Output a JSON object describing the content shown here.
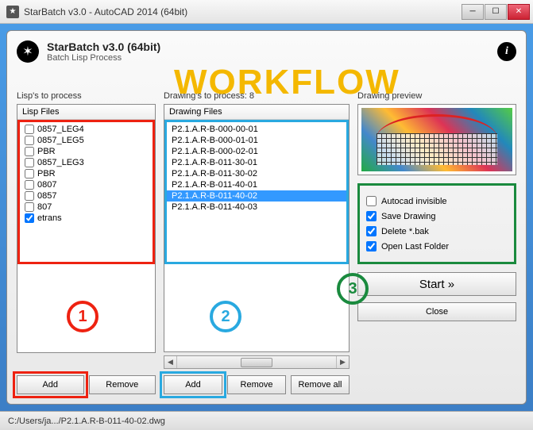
{
  "titlebar": {
    "text": "StarBatch v3.0 - AutoCAD 2014 (64bit)"
  },
  "header": {
    "title": "StarBatch v3.0 (64bit)",
    "subtitle": "Batch Lisp Process"
  },
  "overlay": {
    "workflow": "WORKFLOW"
  },
  "badges": {
    "b1": "1",
    "b2": "2",
    "b3": "3"
  },
  "lisps": {
    "title": "Lisp's to process",
    "header": "Lisp Files",
    "items": [
      {
        "label": "0857_LEG4",
        "checked": false
      },
      {
        "label": "0857_LEG5",
        "checked": false
      },
      {
        "label": "PBR",
        "checked": false
      },
      {
        "label": "0857_LEG3",
        "checked": false
      },
      {
        "label": "PBR",
        "checked": false
      },
      {
        "label": "0807",
        "checked": false
      },
      {
        "label": "0857",
        "checked": false
      },
      {
        "label": "807",
        "checked": false
      },
      {
        "label": "etrans",
        "checked": true
      }
    ],
    "add": "Add",
    "remove": "Remove"
  },
  "drawings": {
    "title": "Drawing's to process: 8",
    "header": "Drawing Files",
    "items": [
      "P2.1.A.R-B-000-00-01",
      "P2.1.A.R-B-000-01-01",
      "P2.1.A.R-B-000-02-01",
      "P2.1.A.R-B-011-30-01",
      "P2.1.A.R-B-011-30-02",
      "P2.1.A.R-B-011-40-01",
      "P2.1.A.R-B-011-40-02",
      "P2.1.A.R-B-011-40-03"
    ],
    "selected_index": 6,
    "add": "Add",
    "remove": "Remove",
    "remove_all": "Remove all"
  },
  "preview": {
    "title": "Drawing preview"
  },
  "options": {
    "items": [
      {
        "label": "Autocad invisible",
        "checked": false
      },
      {
        "label": "Save Drawing",
        "checked": true
      },
      {
        "label": "Delete *.bak",
        "checked": true
      },
      {
        "label": "Open Last Folder",
        "checked": true
      }
    ]
  },
  "actions": {
    "start": "Start »",
    "close": "Close"
  },
  "status": {
    "path": "C:/Users/ja.../P2.1.A.R-B-011-40-02.dwg"
  }
}
